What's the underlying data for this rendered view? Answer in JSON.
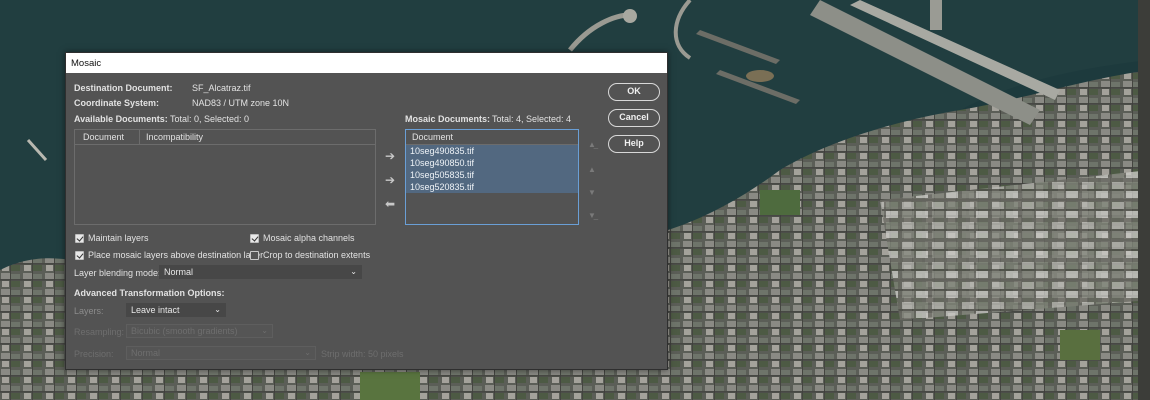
{
  "dialog": {
    "title": "Mosaic",
    "destination_label": "Destination Document:",
    "destination_value": "SF_Alcatraz.tif",
    "coordinate_label": "Coordinate System:",
    "coordinate_value": "NAD83 / UTM zone 10N",
    "available_label": "Available Documents:",
    "available_counts": "Total: 0, Selected: 0",
    "available_columns": [
      "Document",
      "Incompatibility"
    ],
    "mosaic_label": "Mosaic Documents:",
    "mosaic_counts": "Total: 4, Selected: 4",
    "mosaic_column": "Document",
    "mosaic_items": [
      "10seg490835.tif",
      "10seg490850.tif",
      "10seg505835.tif",
      "10seg520835.tif"
    ],
    "buttons": {
      "ok": "OK",
      "cancel": "Cancel",
      "help": "Help"
    },
    "options": {
      "maintain_layers": "Maintain layers",
      "mosaic_alpha": "Mosaic alpha channels",
      "place_above": "Place mosaic layers above destination layer",
      "crop_destination": "Crop to destination extents"
    },
    "blend_label": "Layer blending mode:",
    "blend_value": "Normal",
    "advanced_label": "Advanced Transformation Options:",
    "layers_label": "Layers:",
    "layers_value": "Leave intact",
    "resampling_label": "Resampling:",
    "resampling_value": "Bicubic (smooth gradients)",
    "precision_label": "Precision:",
    "precision_value": "Normal",
    "strip_width": "Strip width: 50 pixels"
  },
  "icons": {
    "add": "arrow-right-icon",
    "remove": "arrow-left-icon",
    "move_top": "move-top-icon",
    "move_up": "move-up-icon",
    "move_down": "move-down-icon",
    "move_bottom": "move-bottom-icon",
    "dropdown": "chevron-down-icon"
  },
  "colors": {
    "dialog_bg": "#535353",
    "selection": "#526880",
    "focus_border": "#6a9fd6"
  }
}
